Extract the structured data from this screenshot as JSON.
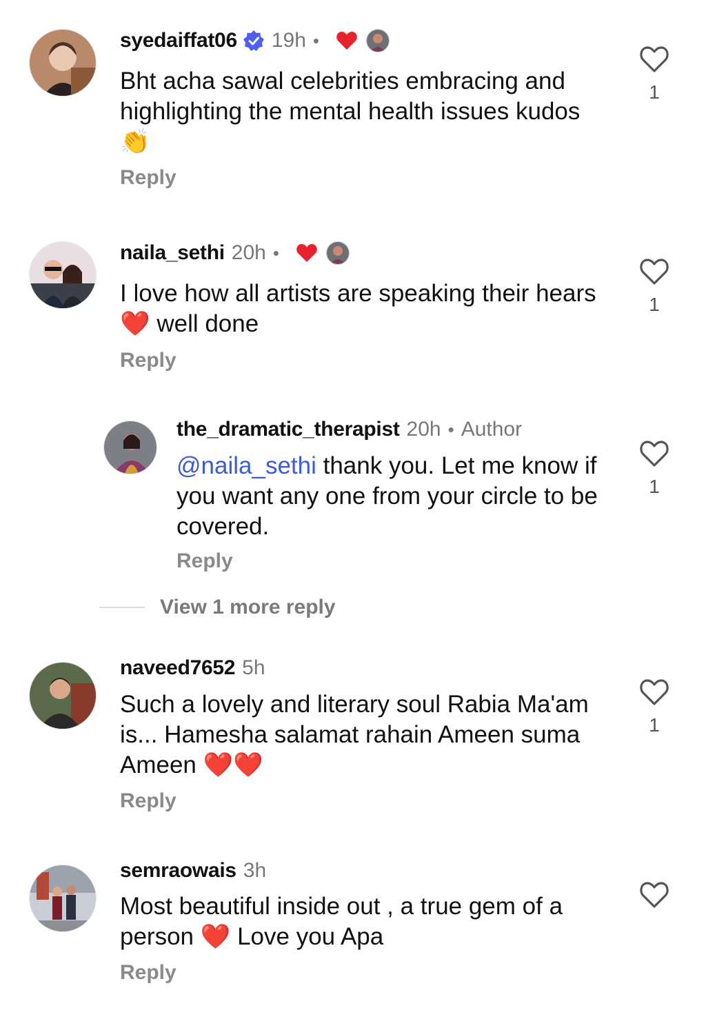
{
  "comments": [
    {
      "username": "syedaiffat06",
      "verified": true,
      "time": "19h",
      "text": "Bht acha sawal celebrities embracing and highlighting the mental health issues kudos",
      "emoji": "👏",
      "like_count": "1",
      "reply_label": "Reply",
      "author_liked": true
    },
    {
      "username": "naila_sethi",
      "time": "20h",
      "text_before": "I love how all artists are speaking their hears",
      "emoji": "❤️",
      "text_after": "well done",
      "like_count": "1",
      "reply_label": "Reply",
      "author_liked": true
    },
    {
      "username": "the_dramatic_therapist",
      "time": "20h",
      "tag": "Author",
      "mention": "@naila_sethi",
      "text": "thank you. Let me know if you want any one from your circle to be covered.",
      "like_count": "1",
      "reply_label": "Reply"
    },
    {
      "username": "naveed7652",
      "time": "5h",
      "text": "Such a lovely and literary soul Rabia Ma'am is... Hamesha salamat rahain Ameen suma Ameen",
      "emoji": "❤️❤️",
      "like_count": "1",
      "reply_label": "Reply"
    },
    {
      "username": "semraowais",
      "time": "3h",
      "text_before": "Most beautiful inside out , a true gem of a person",
      "emoji": "❤️",
      "text_after": "Love you Apa",
      "reply_label": "Reply"
    }
  ],
  "view_more_replies": "View 1 more reply",
  "separator": "•",
  "icons": {
    "like": "heart-outline-icon",
    "liked_by_author": "heart-filled-icon",
    "verified": "verified-badge-icon"
  },
  "colors": {
    "liked_heart": "#e8222d",
    "mention": "#3b5bdb",
    "verified": "#4f5ef5",
    "muted": "#777777"
  }
}
